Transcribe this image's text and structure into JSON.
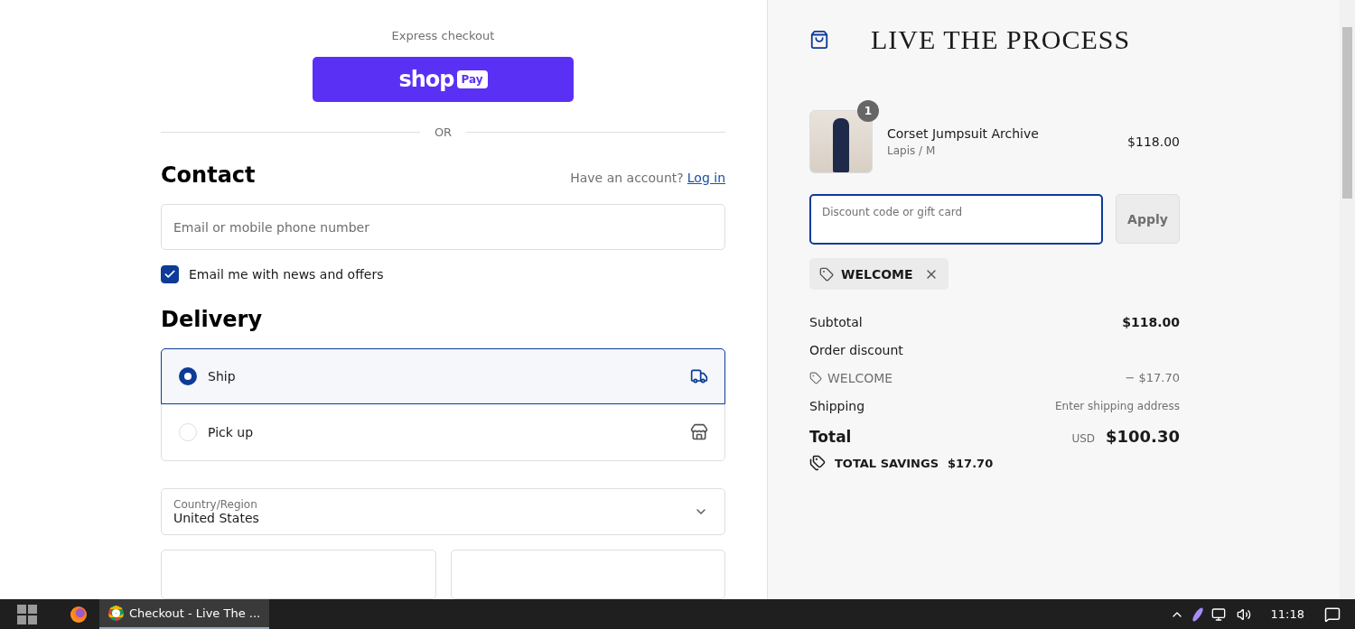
{
  "express": {
    "label": "Express checkout",
    "button": {
      "brand": "shop",
      "badge": "Pay"
    }
  },
  "divider": "OR",
  "contact": {
    "title": "Contact",
    "account_prompt": "Have an account?",
    "login_link": "Log in",
    "email_placeholder": "Email or mobile phone number",
    "newsletter": {
      "label": "Email me with news and offers",
      "checked": true
    }
  },
  "delivery": {
    "title": "Delivery",
    "options": [
      {
        "label": "Ship",
        "kind": "ship",
        "selected": true
      },
      {
        "label": "Pick up",
        "kind": "pickup",
        "selected": false
      }
    ],
    "country": {
      "label": "Country/Region",
      "value": "United States"
    }
  },
  "summary": {
    "brand": "LIVE THE PROCESS",
    "items": [
      {
        "name": "Corset Jumpsuit Archive",
        "variant": "Lapis / M",
        "price": "$118.00",
        "quantity": "1"
      }
    ],
    "discount": {
      "placeholder": "Discount code or gift card",
      "button": "Apply"
    },
    "applied_codes": [
      {
        "code": "WELCOME"
      }
    ],
    "lines": [
      {
        "kind": "plain",
        "label": "Subtotal",
        "value": "$118.00"
      },
      {
        "kind": "heading",
        "label": "Order discount"
      },
      {
        "kind": "code",
        "label": "WELCOME",
        "value": "− $17.70"
      },
      {
        "kind": "note",
        "label": "Shipping",
        "value": "Enter shipping address"
      }
    ],
    "total": {
      "label": "Total",
      "currency": "USD",
      "value": "$100.30"
    },
    "savings": {
      "label": "TOTAL SAVINGS",
      "value": "$17.70"
    }
  },
  "taskbar": {
    "windows": [
      {
        "title": "Checkout - Live The ...",
        "selected": true
      }
    ],
    "clock": "11:18"
  }
}
